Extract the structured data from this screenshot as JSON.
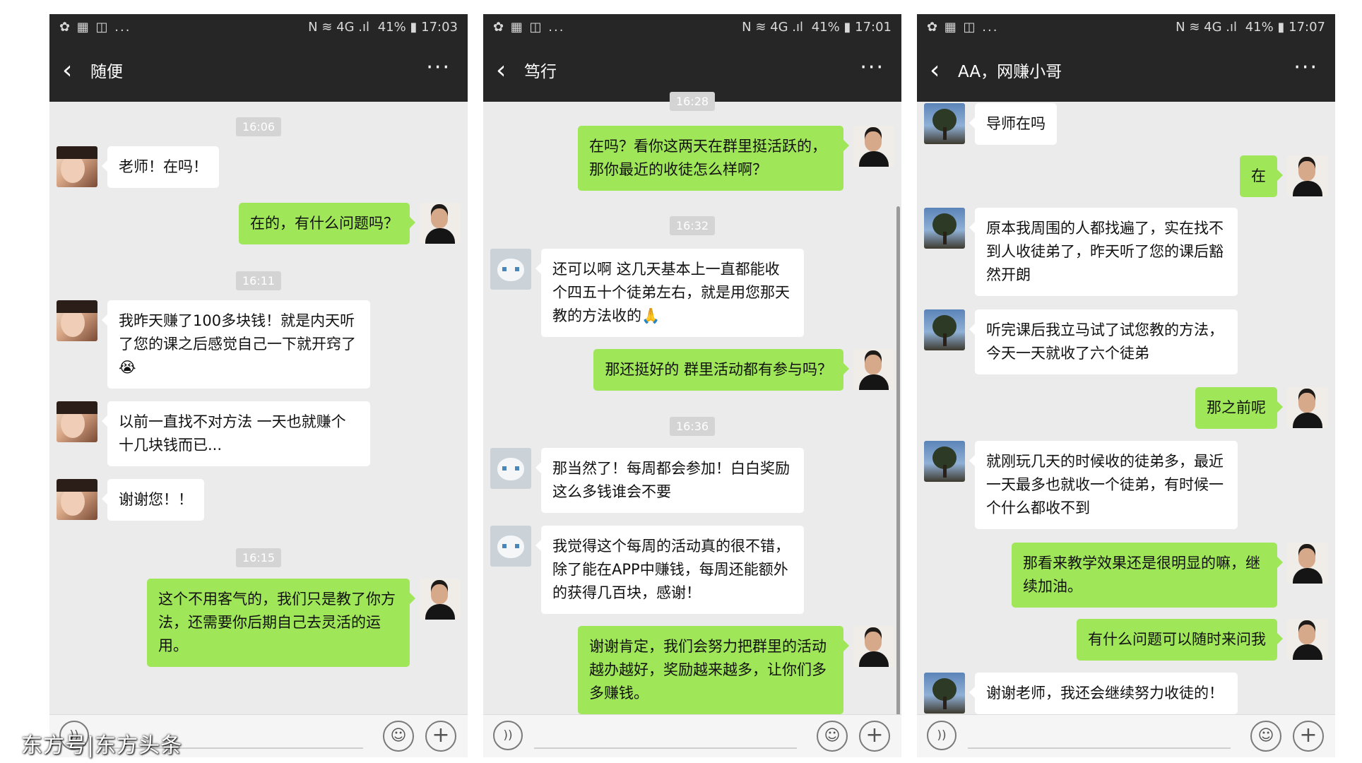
{
  "statusbar": {
    "left_icons": "✿ ▦ ◫ ...",
    "icons_right": "N ≋ 4G .ıl",
    "battery": "41%",
    "times": [
      "17:03",
      "17:01",
      "17:07"
    ]
  },
  "phones": [
    {
      "title": "随便",
      "timestamps": [
        "16:06",
        "16:11",
        "16:15"
      ],
      "messages": [
        {
          "side": "left",
          "avatar": "girl-avatar",
          "text": "老师！在吗！"
        },
        {
          "side": "right",
          "avatar": "man-avatar",
          "text": "在的，有什么问题吗？"
        },
        {
          "side": "left",
          "avatar": "girl-avatar",
          "text": "我昨天赚了100多块钱！就是内天听了您的课之后感觉自己一下就开窍了😭"
        },
        {
          "side": "left",
          "avatar": "girl-avatar",
          "text": "以前一直找不对方法 一天也就赚个十几块钱而已..."
        },
        {
          "side": "left",
          "avatar": "girl-avatar",
          "text": "谢谢您！！"
        },
        {
          "side": "right",
          "avatar": "man-avatar",
          "text": "这个不用客气的，我们只是教了你方法，还需要你后期自己去灵活的运用。"
        }
      ]
    },
    {
      "title": "笃行",
      "timestamps": [
        "16:28",
        "16:32",
        "16:36"
      ],
      "messages": [
        {
          "side": "right",
          "avatar": "man-avatar",
          "text": "在吗？看你这两天在群里挺活跃的，那你最近的收徒怎么样啊？"
        },
        {
          "side": "left",
          "avatar": "cat-avatar",
          "text": "还可以啊 这几天基本上一直都能收个四五十个徒弟左右，就是用您那天教的方法收的🙏"
        },
        {
          "side": "right",
          "avatar": "man-avatar",
          "text": "那还挺好的 群里活动都有参与吗？"
        },
        {
          "side": "left",
          "avatar": "cat-avatar",
          "text": "那当然了！每周都会参加！白白奖励这么多钱谁会不要"
        },
        {
          "side": "left",
          "avatar": "cat-avatar",
          "text": "我觉得这个每周的活动真的很不错，除了能在APP中赚钱，每周还能额外的获得几百块，感谢！"
        },
        {
          "side": "right",
          "avatar": "man-avatar",
          "text": "谢谢肯定，我们会努力把群里的活动越办越好，奖励越来越多，让你们多多赚钱。"
        }
      ]
    },
    {
      "title": "AA，网赚小哥",
      "timestamps": [],
      "messages": [
        {
          "side": "left",
          "avatar": "tree-avatar",
          "text": "导师在吗"
        },
        {
          "side": "right",
          "avatar": "man-avatar",
          "text": "在"
        },
        {
          "side": "left",
          "avatar": "tree-avatar",
          "text": "原本我周围的人都找遍了，实在找不到人收徒弟了，昨天听了您的课后豁然开朗"
        },
        {
          "side": "left",
          "avatar": "tree-avatar",
          "text": "听完课后我立马试了试您教的方法，今天一天就收了六个徒弟"
        },
        {
          "side": "right",
          "avatar": "man-avatar",
          "text": "那之前呢"
        },
        {
          "side": "left",
          "avatar": "tree-avatar",
          "text": "就刚玩几天的时候收的徒弟多，最近一天最多也就收一个徒弟，有时候一个什么都收不到"
        },
        {
          "side": "right",
          "avatar": "man-avatar",
          "text": "那看来教学效果还是很明显的嘛，继续加油。"
        },
        {
          "side": "right",
          "avatar": "man-avatar",
          "text": "有什么问题可以随时来问我"
        },
        {
          "side": "left",
          "avatar": "tree-avatar",
          "text": "谢谢老师，我还会继续努力收徒的！"
        }
      ]
    }
  ],
  "icons": {
    "back": "‹",
    "more": "···",
    "voice": "))",
    "emoji": "☺",
    "plus": "+"
  },
  "watermark": "东方号|东方头条"
}
